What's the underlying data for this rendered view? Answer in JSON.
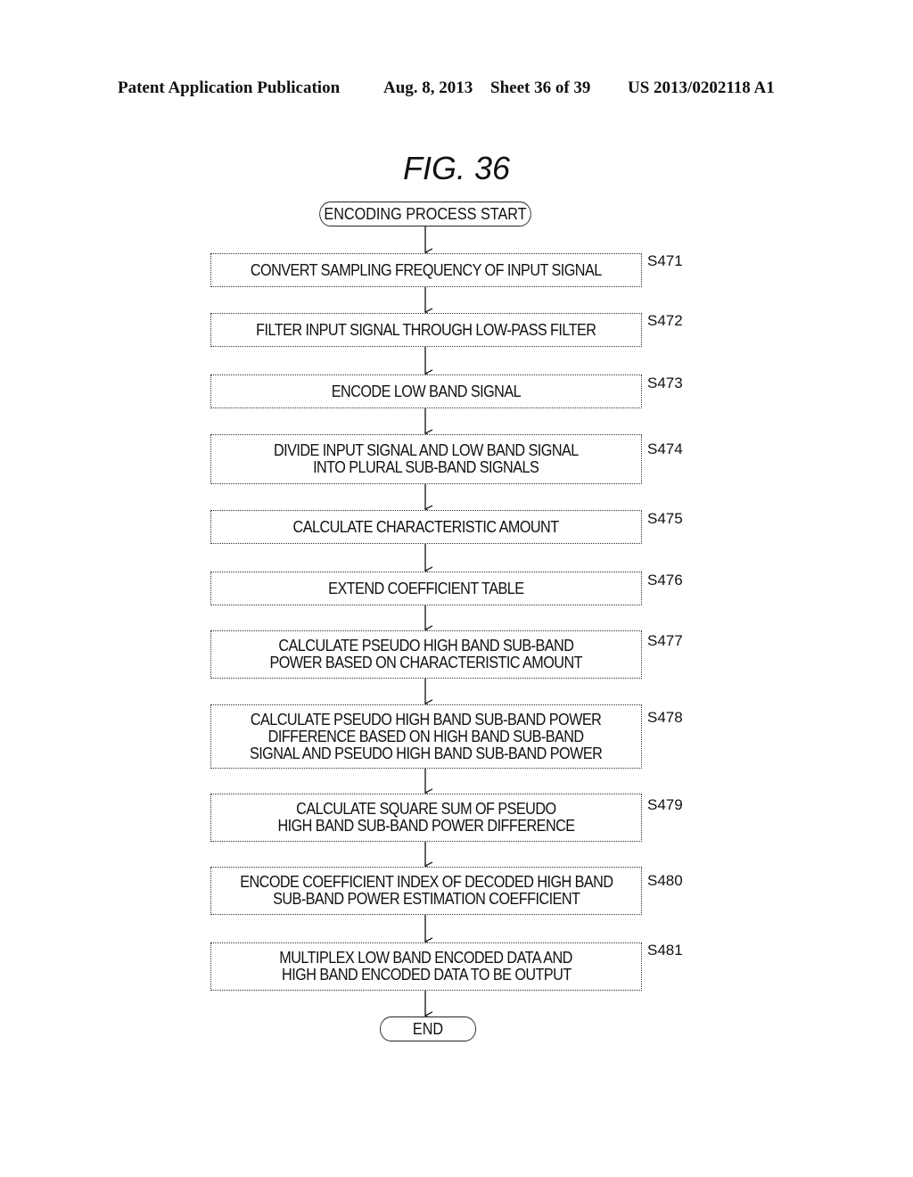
{
  "header": {
    "publication": "Patent Application Publication",
    "date": "Aug. 8, 2013",
    "sheet": "Sheet 36 of 39",
    "number": "US 2013/0202118 A1"
  },
  "figure": {
    "title": "FIG. 36",
    "start_label": "ENCODING PROCESS START",
    "end_label": "END",
    "steps": [
      {
        "id": "S471",
        "lines": [
          "CONVERT SAMPLING FREQUENCY OF INPUT SIGNAL"
        ]
      },
      {
        "id": "S472",
        "lines": [
          "FILTER INPUT SIGNAL THROUGH LOW-PASS FILTER"
        ]
      },
      {
        "id": "S473",
        "lines": [
          "ENCODE LOW BAND SIGNAL"
        ]
      },
      {
        "id": "S474",
        "lines": [
          "DIVIDE INPUT SIGNAL AND LOW BAND SIGNAL",
          "INTO PLURAL SUB-BAND SIGNALS"
        ]
      },
      {
        "id": "S475",
        "lines": [
          "CALCULATE CHARACTERISTIC AMOUNT"
        ]
      },
      {
        "id": "S476",
        "lines": [
          "EXTEND COEFFICIENT TABLE"
        ]
      },
      {
        "id": "S477",
        "lines": [
          "CALCULATE PSEUDO HIGH BAND SUB-BAND",
          "POWER BASED ON CHARACTERISTIC AMOUNT"
        ]
      },
      {
        "id": "S478",
        "lines": [
          "CALCULATE PSEUDO HIGH BAND SUB-BAND POWER",
          "DIFFERENCE BASED ON HIGH BAND SUB-BAND",
          "SIGNAL AND PSEUDO HIGH BAND SUB-BAND POWER"
        ]
      },
      {
        "id": "S479",
        "lines": [
          "CALCULATE SQUARE SUM OF PSEUDO",
          "HIGH BAND SUB-BAND POWER DIFFERENCE"
        ]
      },
      {
        "id": "S480",
        "lines": [
          "ENCODE COEFFICIENT INDEX OF DECODED HIGH BAND",
          "SUB-BAND POWER ESTIMATION COEFFICIENT"
        ]
      },
      {
        "id": "S481",
        "lines": [
          "MULTIPLEX LOW BAND ENCODED DATA AND",
          "HIGH BAND ENCODED DATA TO BE OUTPUT"
        ]
      }
    ]
  }
}
